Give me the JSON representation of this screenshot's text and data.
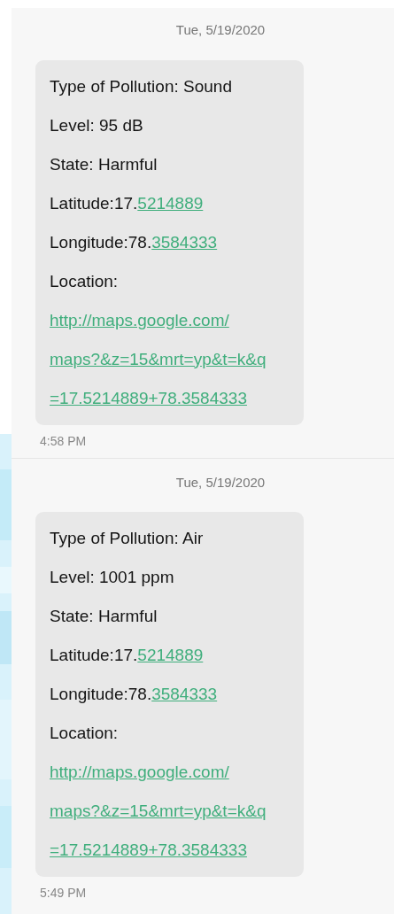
{
  "messages": [
    {
      "date": "Tue, 5/19/2020",
      "lines": [
        {
          "text": "Type of Pollution: Sound"
        },
        {
          "text": "Level: 95 dB"
        },
        {
          "text": "State: Harmful"
        },
        {
          "text": "Latitude:17.",
          "link": "5214889"
        },
        {
          "text": "Longitude:78.",
          "link": "3584333"
        },
        {
          "text": "Location:"
        },
        {
          "link": "http://maps.google.com/"
        },
        {
          "link": "maps?&z=15&mrt=yp&t=k&q"
        },
        {
          "link": "=17.5214889+78.3584333"
        }
      ],
      "time": "4:58 PM"
    },
    {
      "date": "Tue, 5/19/2020",
      "lines": [
        {
          "text": "Type of Pollution: Air"
        },
        {
          "text": "Level: 1001 ppm"
        },
        {
          "text": "State: Harmful"
        },
        {
          "text": "Latitude:17.",
          "link": "5214889"
        },
        {
          "text": "Longitude:78.",
          "link": "3584333"
        },
        {
          "text": "Location:"
        },
        {
          "link": "http://maps.google.com/"
        },
        {
          "link": "maps?&z=15&mrt=yp&t=k&q"
        },
        {
          "link": "=17.5214889+78.3584333"
        }
      ],
      "time": "5:49 PM"
    }
  ]
}
